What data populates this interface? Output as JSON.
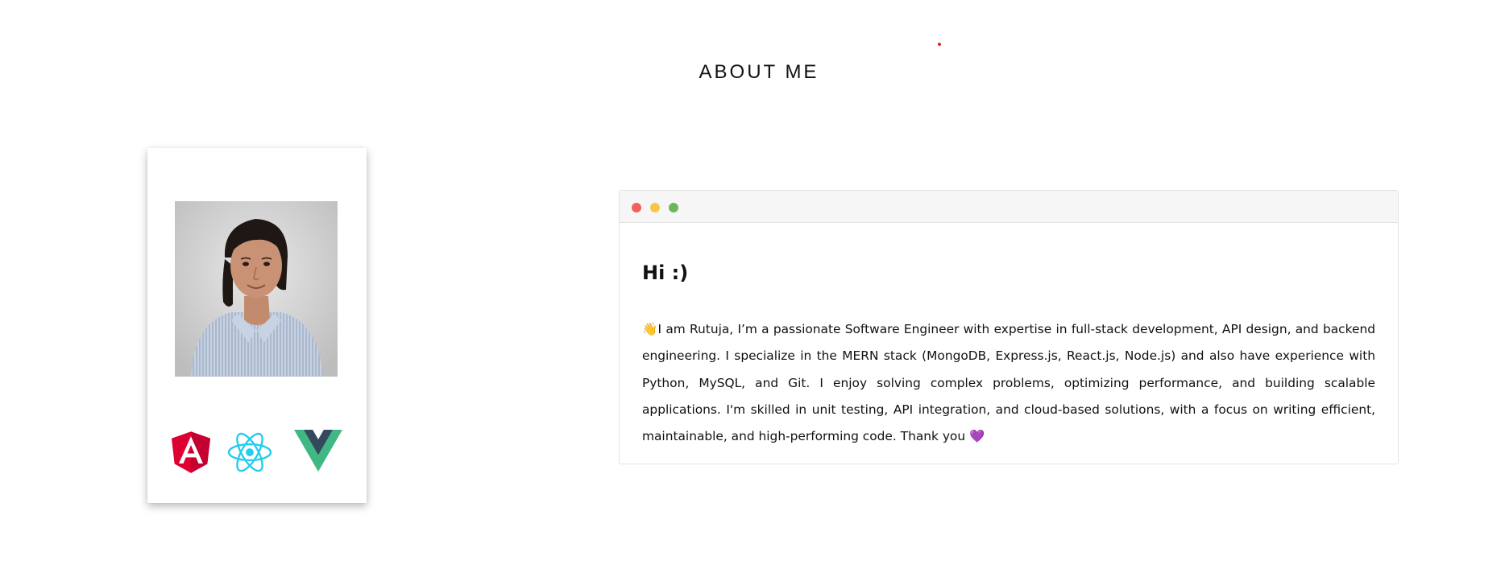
{
  "section": {
    "title": "ABOUT ME"
  },
  "profile": {
    "tech_icons": [
      "angular-icon",
      "react-icon",
      "vue-icon"
    ]
  },
  "window": {
    "dots": {
      "red": "#f25f5c",
      "yellow": "#f7c744",
      "green": "#6cb65b"
    }
  },
  "about": {
    "greeting": "Hi :)",
    "wave_emoji": "👋",
    "bio_text": "I am Rutuja, I’m a passionate Software Engineer with expertise in full-stack development, API design, and backend engineering. I specialize in the MERN stack (MongoDB, Express.js, React.js, Node.js) and also have experience with Python, MySQL, and Git. I enjoy solving complex problems, optimizing performance, and building scalable applications. I'm skilled in unit testing, API integration, and cloud-based solutions, with a focus on writing efficient, maintainable, and high-performing code. Thank you",
    "heart_emoji": "💜"
  }
}
